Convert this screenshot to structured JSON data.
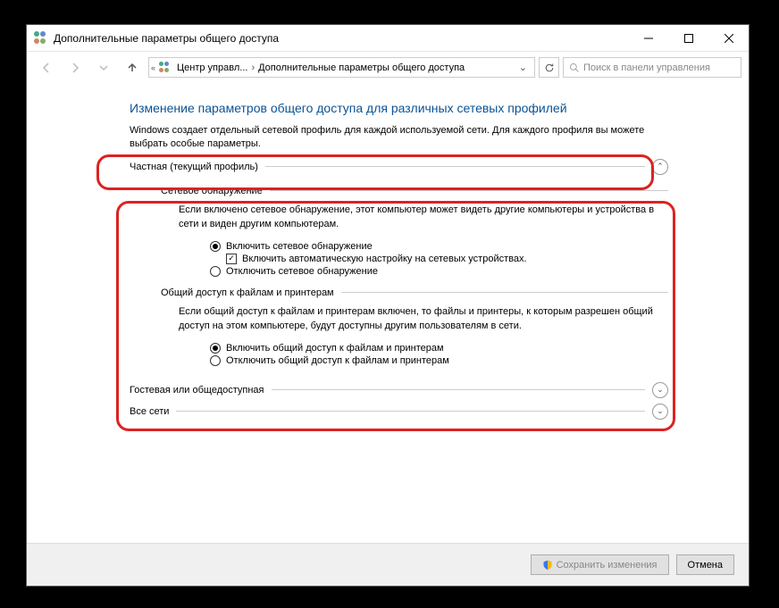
{
  "window": {
    "title": "Дополнительные параметры общего доступа"
  },
  "breadcrumb": {
    "seg1": "Центр управл...",
    "seg2": "Дополнительные параметры общего доступа"
  },
  "search": {
    "placeholder": "Поиск в панели управления"
  },
  "heading": "Изменение параметров общего доступа для различных сетевых профилей",
  "subtext": "Windows создает отдельный сетевой профиль для каждой используемой сети. Для каждого профиля вы можете выбрать особые параметры.",
  "profiles": {
    "private": {
      "title": "Частная (текущий профиль)",
      "discovery": {
        "group_title": "Сетевое обнаружение",
        "desc": "Если включено сетевое обнаружение, этот компьютер может видеть другие компьютеры и устройства в сети и виден другим компьютерам.",
        "radio_on": "Включить сетевое обнаружение",
        "check_auto": "Включить автоматическую настройку на сетевых устройствах.",
        "radio_off": "Отключить сетевое обнаружение"
      },
      "sharing": {
        "group_title": "Общий доступ к файлам и принтерам",
        "desc": "Если общий доступ к файлам и принтерам включен, то файлы и принтеры, к которым разрешен общий доступ на этом компьютере, будут доступны другим пользователям в сети.",
        "radio_on": "Включить общий доступ к файлам и принтерам",
        "radio_off": "Отключить общий доступ к файлам и принтерам"
      }
    },
    "guest": {
      "title": "Гостевая или общедоступная"
    },
    "all": {
      "title": "Все сети"
    }
  },
  "footer": {
    "save": "Сохранить изменения",
    "cancel": "Отмена"
  }
}
